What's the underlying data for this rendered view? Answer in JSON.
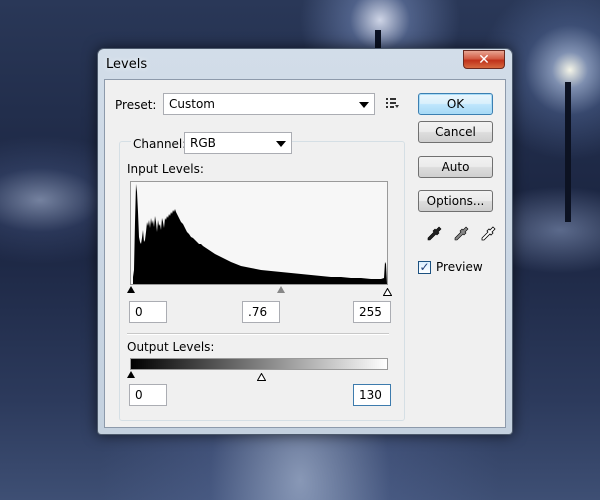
{
  "dialog": {
    "title": "Levels",
    "close_glyph": "✕",
    "preset": {
      "label": "Preset:",
      "value": "Custom"
    },
    "channel": {
      "label": "Channel:",
      "value": "RGB"
    },
    "input_levels": {
      "label": "Input Levels:",
      "black": "0",
      "gamma": ".76",
      "white": "255"
    },
    "output_levels": {
      "label": "Output Levels:",
      "black": "0",
      "white": "130"
    },
    "buttons": {
      "ok": "OK",
      "cancel": "Cancel",
      "auto": "Auto",
      "options": "Options..."
    },
    "preview": {
      "label": "Preview",
      "checked": true,
      "check_glyph": "✓"
    },
    "icons": [
      "preset-menu-icon",
      "black-eyedropper-icon",
      "gray-eyedropper-icon",
      "white-eyedropper-icon"
    ]
  }
}
